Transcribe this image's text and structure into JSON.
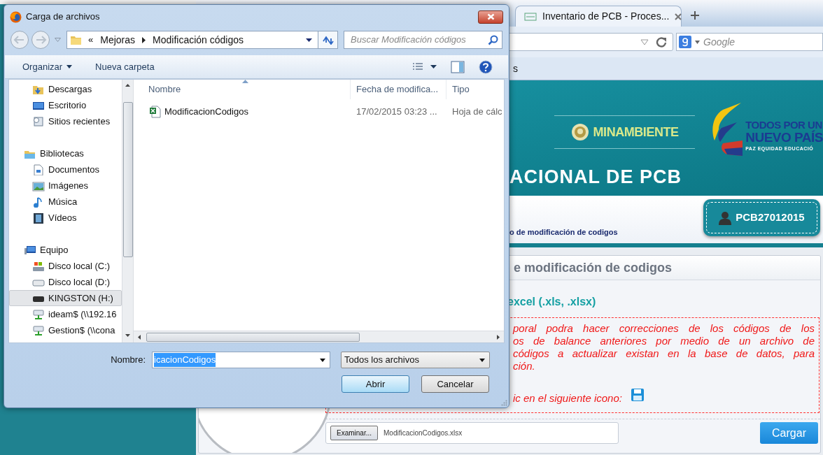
{
  "browser": {
    "tab": {
      "title": "Inventario de PCB - Proces...",
      "selected": true
    },
    "search_placeholder": "Google",
    "bookmark": "s"
  },
  "page": {
    "ministry": "MINAMBIENTE",
    "slogan": [
      "TODOS POR UN",
      "NUEVO PAÍS",
      "PAZ EQUIDAD EDUCACIÓ"
    ],
    "title": "ACIONAL DE PCB",
    "breadcrumb": "o de modificación de codigos",
    "user": "PCB27012015",
    "panel_title": "e modificación de codigos",
    "format_note": "excel (.xls, .xlsx)",
    "notice_lines": [
      "poral podra hacer correcciones de los códigos de los",
      "os de balance anteriores por medio de un archivo de",
      "códigos a actualizar existan en la base de datos, para",
      "ción.",
      "ic en el siguiente icono:"
    ],
    "file_input": {
      "button": "Examinar...",
      "file": "ModificacionCodigos.xlsx"
    },
    "submit": "Cargar"
  },
  "dialog": {
    "title": "Carga de archivos",
    "path_overflow": "«",
    "path": [
      "Mejoras",
      "Modificación códigos"
    ],
    "search_placeholder": "Buscar Modificación códigos",
    "toolbar": [
      {
        "label": "Organizar",
        "menu": true
      },
      {
        "label": "Nueva carpeta",
        "menu": false
      }
    ],
    "nav_tree": [
      {
        "children": [
          {
            "label": "Descargas",
            "selected": false
          },
          {
            "label": "Escritorio",
            "selected": false
          },
          {
            "label": "Sitios recientes",
            "selected": false
          }
        ]
      },
      {
        "label": "Bibliotecas",
        "selected": false,
        "children": [
          {
            "label": "Documentos",
            "selected": false
          },
          {
            "label": "Imágenes",
            "selected": false
          },
          {
            "label": "Música",
            "selected": false
          },
          {
            "label": "Vídeos",
            "selected": false
          }
        ]
      },
      {
        "label": "Equipo",
        "selected": false,
        "children": [
          {
            "label": "Disco local (C:)",
            "selected": false
          },
          {
            "label": "Disco local (D:)",
            "selected": false
          },
          {
            "label": "KINGSTON (H:)",
            "selected": true
          },
          {
            "label": "ideam$ (\\\\192.16",
            "selected": false
          },
          {
            "label": "Gestion$ (\\\\cona",
            "selected": false
          }
        ]
      }
    ],
    "columns": [
      {
        "label": "Nombre",
        "sorted": true
      },
      {
        "label": "Fecha de modifica...",
        "sorted": false
      },
      {
        "label": "Tipo",
        "sorted": false
      }
    ],
    "files": [
      {
        "name": "ModificacionCodigos",
        "date": "17/02/2015 03:23 ...",
        "type": "Hoja de cálc"
      }
    ],
    "filename": {
      "label": "Nombre:",
      "value": "icacionCodigos",
      "highlighted": true
    },
    "filter": "Todos los archivos",
    "buttons": [
      {
        "label": "Abrir",
        "default": true
      },
      {
        "label": "Cancelar",
        "default": false
      }
    ]
  }
}
